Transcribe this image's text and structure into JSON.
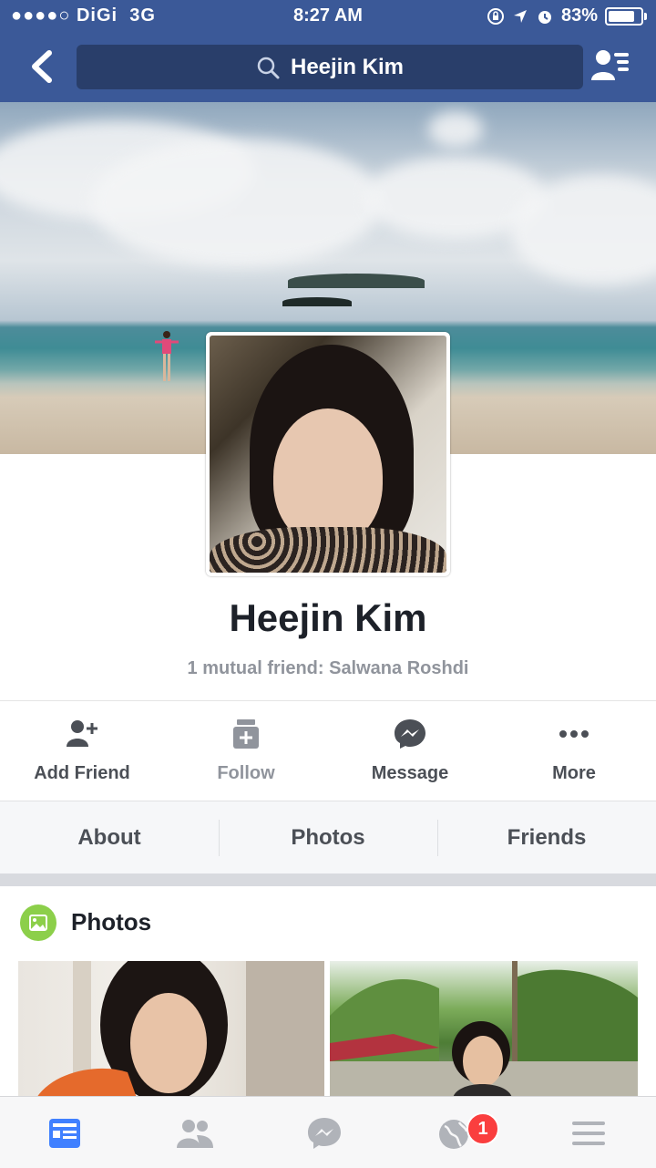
{
  "status_bar": {
    "carrier": "●●●●○ DiGi",
    "network": "3G",
    "time": "8:27 AM",
    "battery_percent": "83%",
    "battery_level": 0.83
  },
  "nav": {
    "search_text": "Heejin Kim",
    "back_icon": "chevron-left-icon",
    "friend_requests_icon": "friend-list-icon"
  },
  "profile": {
    "name": "Heejin Kim",
    "mutual_friends": "1 mutual friend: Salwana Roshdi"
  },
  "actions": [
    {
      "label": "Add Friend",
      "icon": "add-friend-icon"
    },
    {
      "label": "Follow",
      "icon": "follow-icon"
    },
    {
      "label": "Message",
      "icon": "messenger-icon"
    },
    {
      "label": "More",
      "icon": "more-icon"
    }
  ],
  "tabs": [
    {
      "label": "About"
    },
    {
      "label": "Photos"
    },
    {
      "label": "Friends"
    }
  ],
  "photos_section": {
    "title": "Photos"
  },
  "bottom_nav": {
    "items": [
      "news-feed-icon",
      "friends-icon",
      "messenger-icon",
      "notifications-globe-icon",
      "menu-icon"
    ],
    "notification_badge": "1"
  },
  "colors": {
    "brand": "#3b5998",
    "badge": "#fa3e3e",
    "photos_icon": "#8ccf4a"
  }
}
